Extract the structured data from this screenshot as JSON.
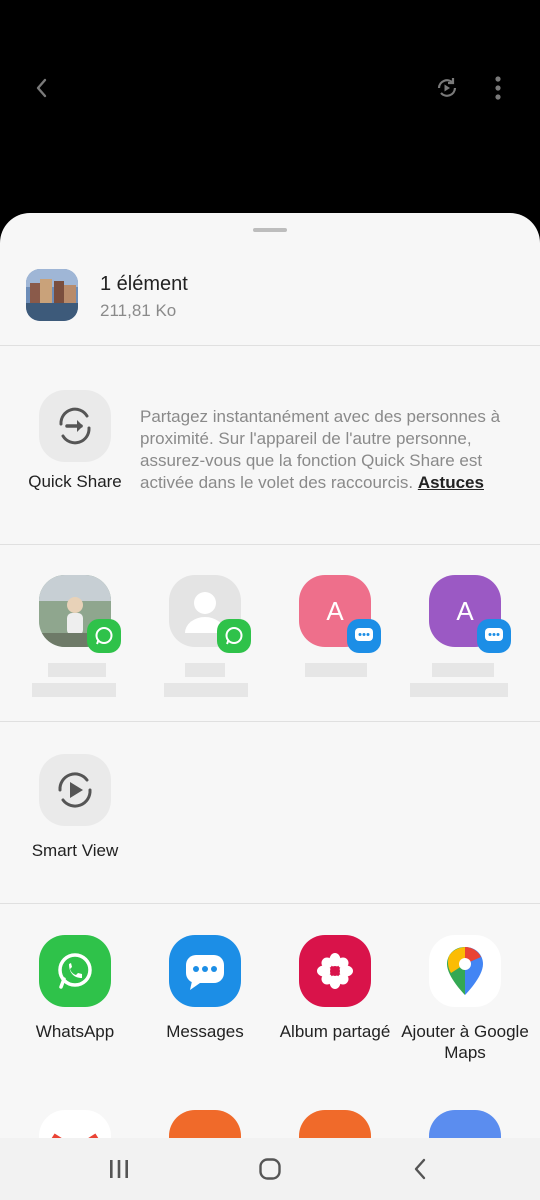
{
  "top_bar": {
    "back_icon": "chevron-left-icon",
    "rotate_icon": "rotate-screen-icon",
    "menu_icon": "more-vertical-icon"
  },
  "share_item": {
    "title": "1 élément",
    "size": "211,81 Ko"
  },
  "quick_share": {
    "label": "Quick Share",
    "description": "Partagez instantanément avec des personnes à proximité. Sur l'appareil de l'autre personne, assurez-vous que la fonction Quick Share est activée dans le volet des raccourcis.",
    "tips_link": "Astuces"
  },
  "contacts": [
    {
      "avatar": "photo",
      "app_badge": "whatsapp"
    },
    {
      "avatar": "default-person",
      "app_badge": "whatsapp"
    },
    {
      "avatar_letter": "A",
      "color": "#ee6f8b",
      "app_badge": "messages"
    },
    {
      "avatar_letter": "A",
      "color": "#9b59c4",
      "app_badge": "messages"
    }
  ],
  "smart_view": {
    "label": "Smart View"
  },
  "apps": [
    {
      "label": "WhatsApp",
      "color": "#2fc24a"
    },
    {
      "label": "Messages",
      "color": "#1c8ee6"
    },
    {
      "label": "Album partagé",
      "color": "#d9134a"
    },
    {
      "label": "Ajouter à Google Maps",
      "color": "#ffffff"
    }
  ],
  "nav_bar": {
    "recents_icon": "recents-icon",
    "home_icon": "home-icon",
    "back_icon": "back-icon"
  }
}
